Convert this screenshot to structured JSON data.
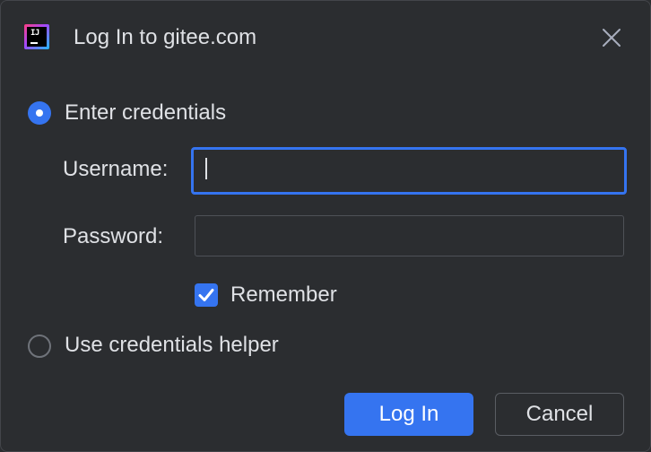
{
  "window": {
    "title": "Log In to gitee.com",
    "app_icon": "intellij-idea-icon",
    "app_icon_text": "IJ",
    "close_icon": "close-icon"
  },
  "options": {
    "enter_credentials": {
      "label": "Enter credentials",
      "selected": true
    },
    "credentials_helper": {
      "label": "Use credentials helper",
      "selected": false
    }
  },
  "form": {
    "username_label": "Username:",
    "username_value": "",
    "password_label": "Password:",
    "password_value": "",
    "remember_label": "Remember",
    "remember_checked": true
  },
  "buttons": {
    "login_label": "Log In",
    "cancel_label": "Cancel"
  },
  "colors": {
    "accent": "#3574f0",
    "background": "#2b2d30",
    "text": "#dfe1e5"
  }
}
